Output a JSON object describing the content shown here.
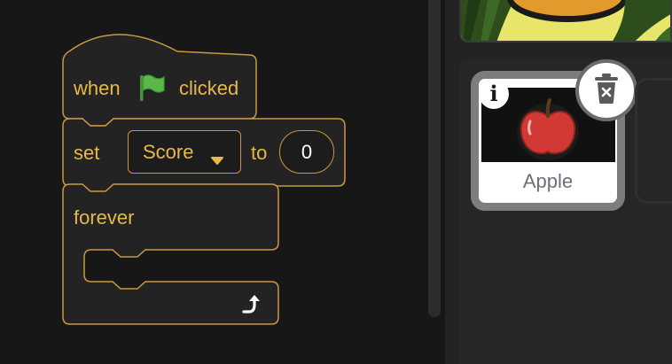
{
  "code": {
    "hat_block": {
      "when_label": "when",
      "flag_icon": "green-flag-icon",
      "clicked_label": "clicked"
    },
    "set_block": {
      "set_label": "set",
      "variable_value": "Score",
      "to_label": "to",
      "number_value": "0"
    },
    "forever_block": {
      "label": "forever",
      "loop_icon": "loop-arrow-icon"
    }
  },
  "sprites": {
    "selected": {
      "name": "Apple",
      "info_icon": "info-icon",
      "delete_icon": "trash-delete-icon"
    }
  },
  "colors": {
    "block_outline": "#c99a3d",
    "block_text": "#e8b84a",
    "flag": "#4caf3e",
    "background": "#171717"
  }
}
